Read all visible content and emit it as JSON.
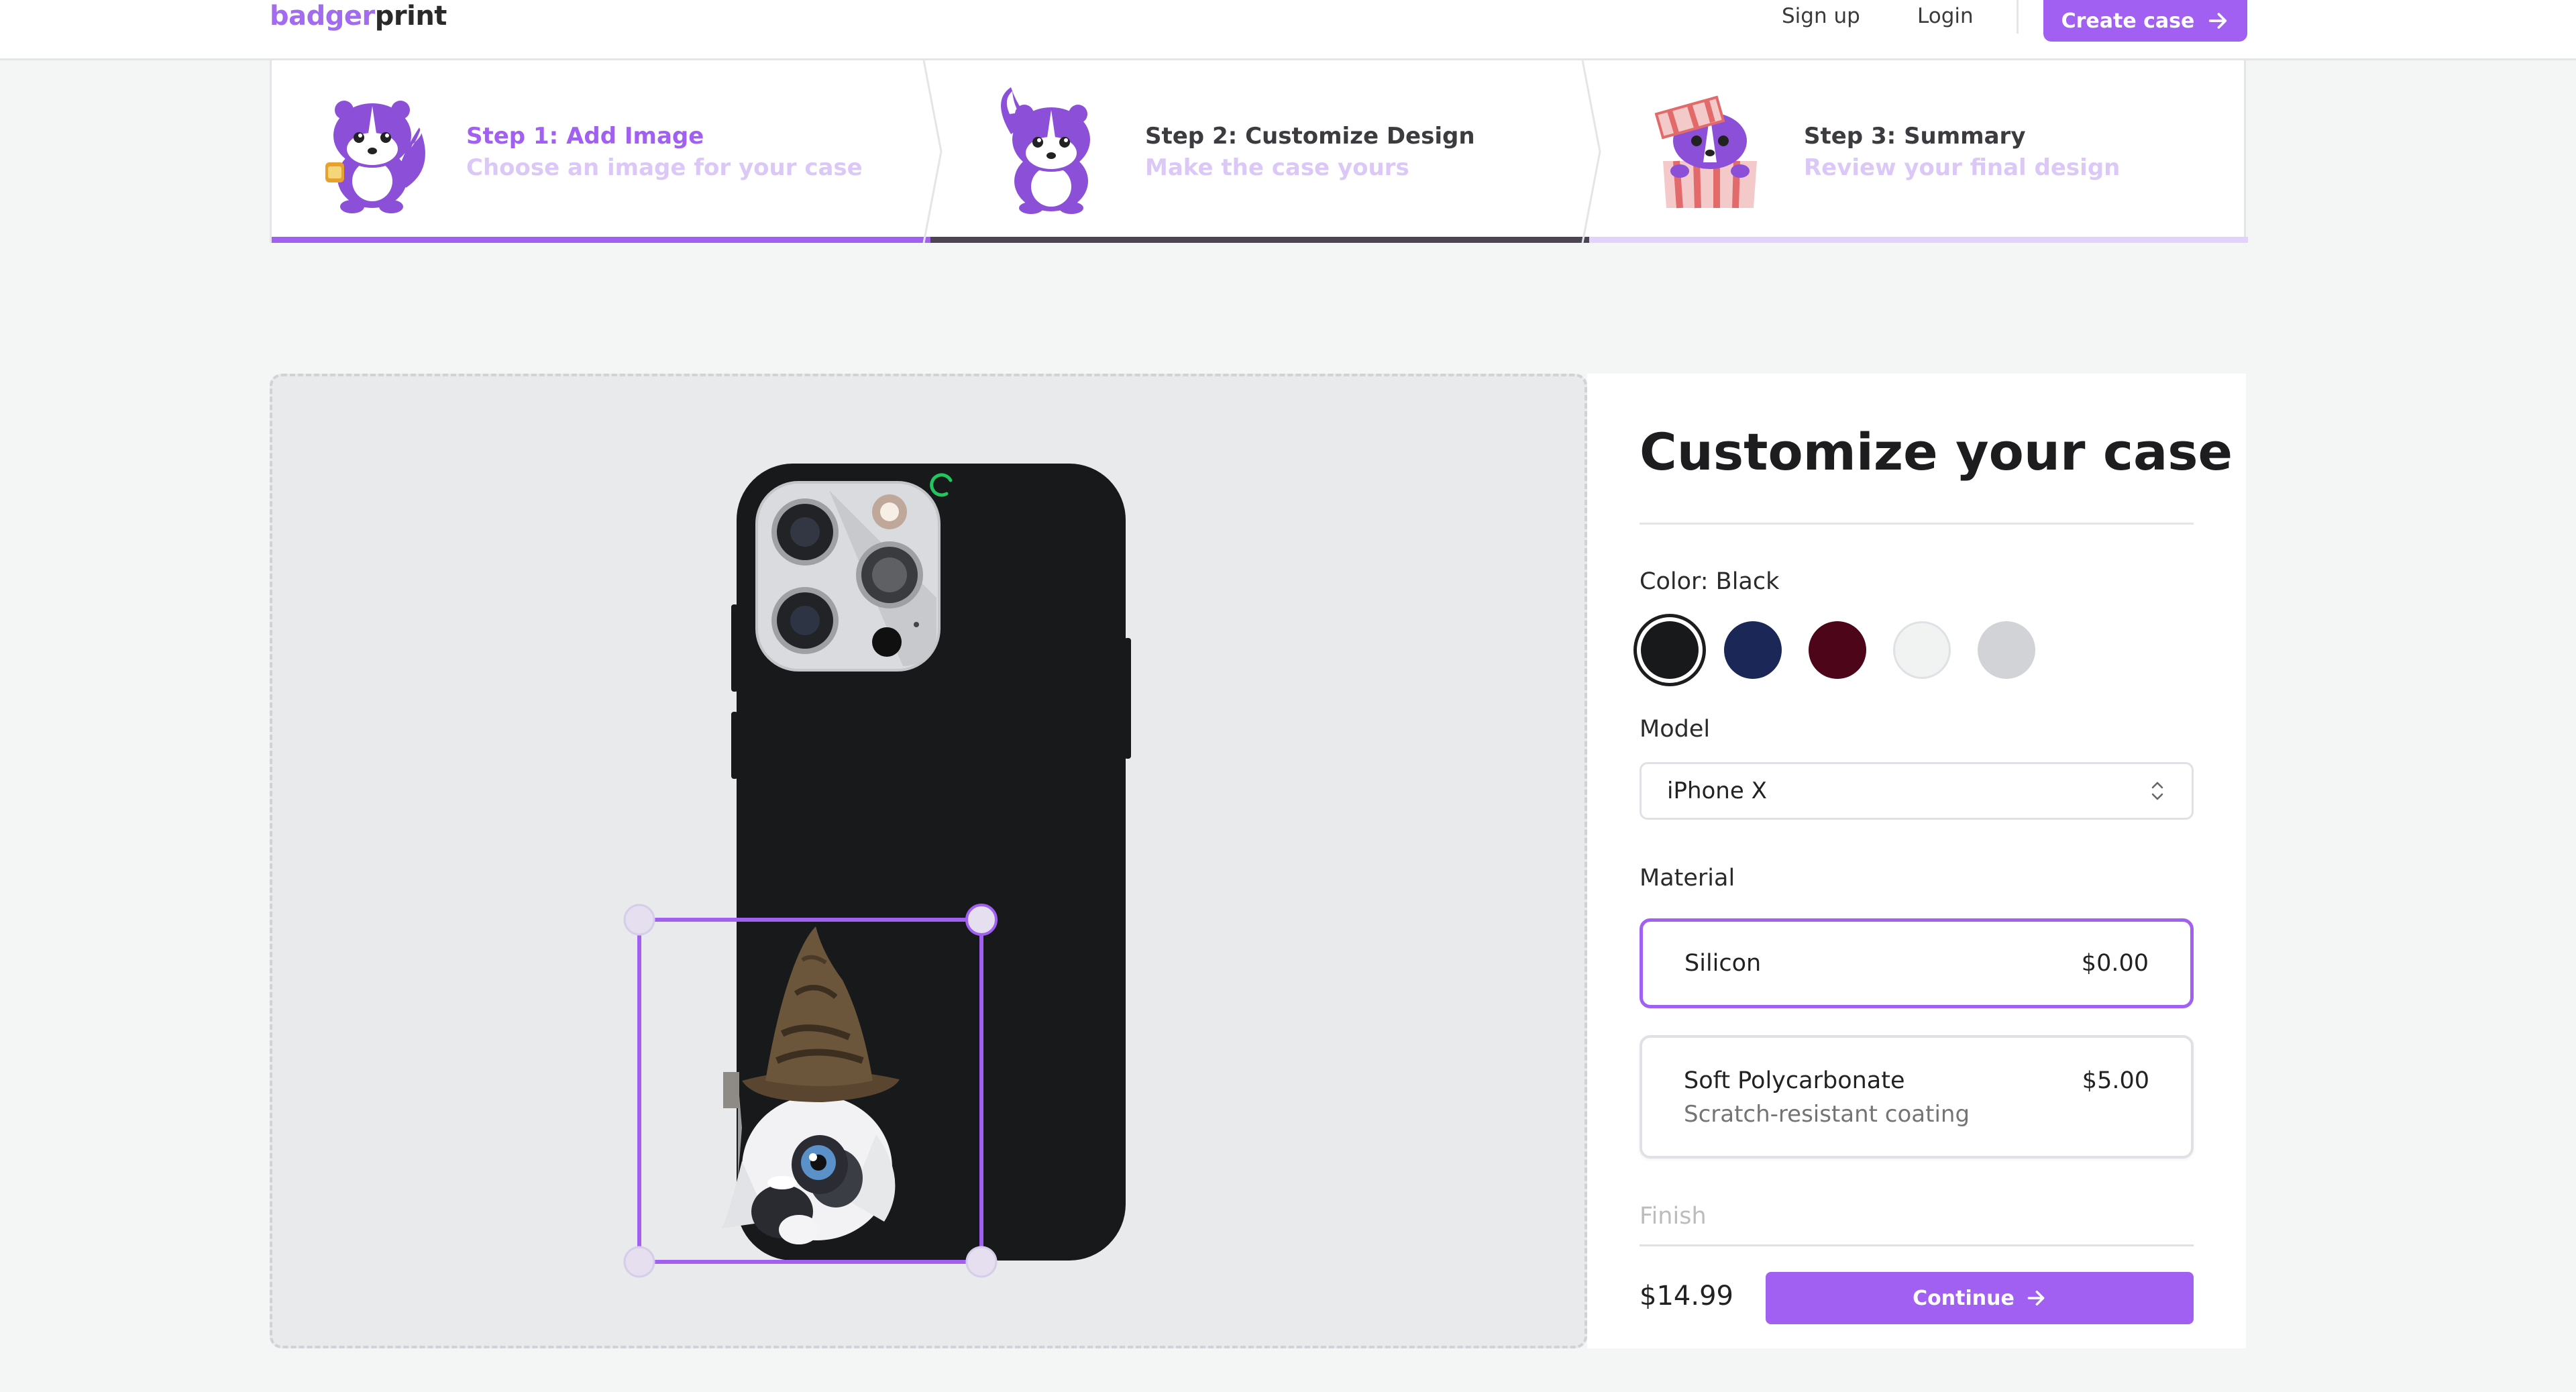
{
  "nav": {
    "logo_part1": "badger",
    "logo_part2": "print",
    "signup": "Sign up",
    "login": "Login",
    "create_case": "Create case"
  },
  "steps": [
    {
      "title": "Step 1: Add Image",
      "subtitle": "Choose an image for your case",
      "state": "complete"
    },
    {
      "title": "Step 2: Customize Design",
      "subtitle": "Make the case yours",
      "state": "current"
    },
    {
      "title": "Step 3: Summary",
      "subtitle": "Review your final design",
      "state": "upcoming"
    }
  ],
  "panel": {
    "title": "Customize your case",
    "color_label": "Color: Black",
    "colors": [
      {
        "name": "Black",
        "hex": "#18191b",
        "selected": true
      },
      {
        "name": "Blue",
        "hex": "#1b2756",
        "selected": false
      },
      {
        "name": "Rose",
        "hex": "#4c0519",
        "selected": false
      },
      {
        "name": "White",
        "hex": "#f1f2f2",
        "selected": false
      },
      {
        "name": "Gray",
        "hex": "#d1d3d6",
        "selected": false
      }
    ],
    "model_label": "Model",
    "model_value": "iPhone X",
    "material_label": "Material",
    "materials": [
      {
        "name": "Silicon",
        "price": "$0.00",
        "description": "",
        "selected": true
      },
      {
        "name": "Soft Polycarbonate",
        "price": "$5.00",
        "description": "Scratch-resistant coating",
        "selected": false
      }
    ],
    "finish_label": "Finish",
    "total": "$14.99",
    "continue": "Continue"
  },
  "colors": {
    "accent": "#a260f3",
    "step_complete": "#a260f3",
    "step_current": "#4b4453",
    "step_upcoming": "#e3d2fb"
  }
}
